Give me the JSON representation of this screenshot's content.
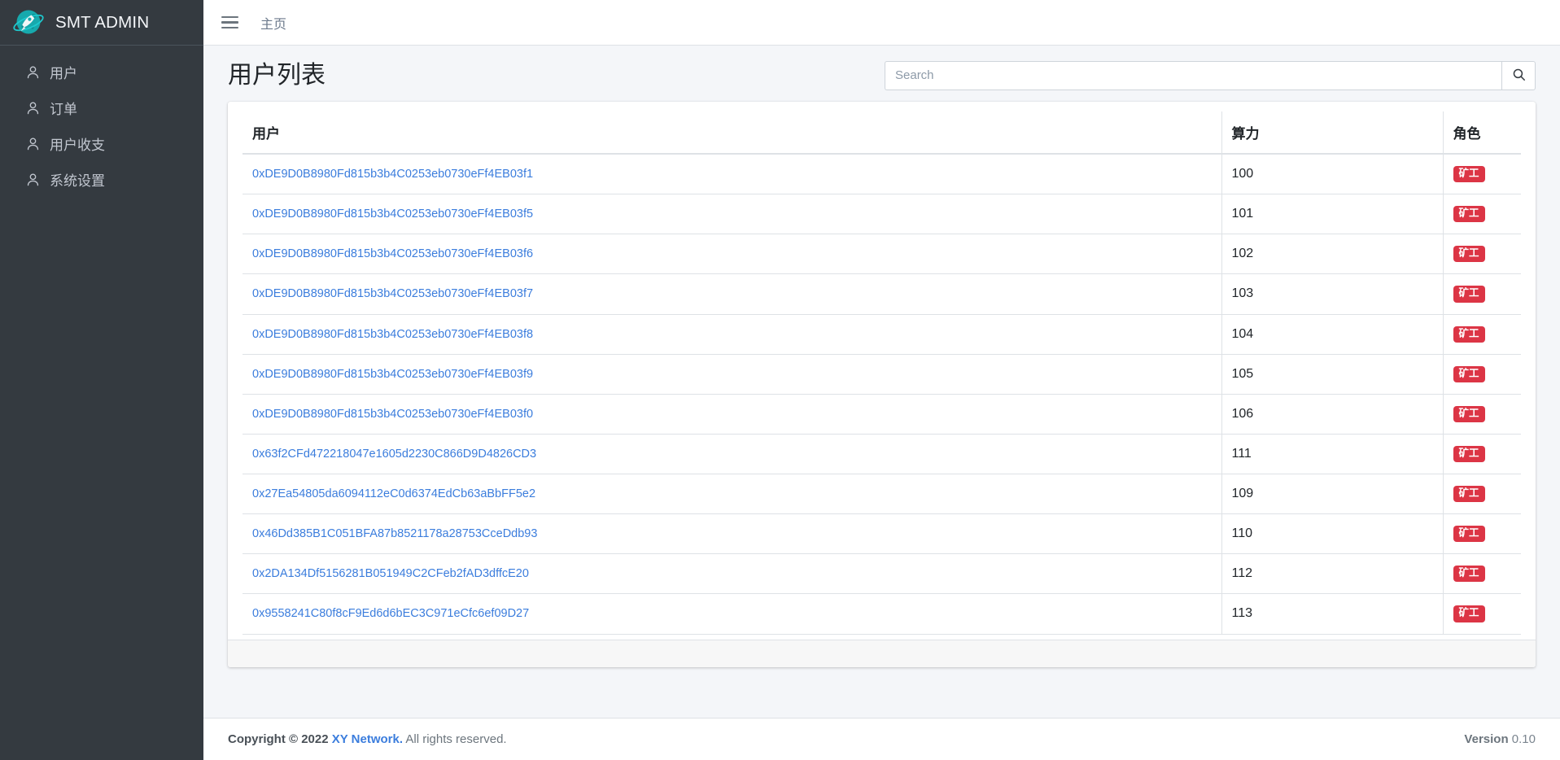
{
  "sidebar": {
    "brand": {
      "title": "SMT ADMIN",
      "logo_icon": "rocket-planet-logo"
    },
    "items": [
      {
        "label": "用户",
        "icon": "user-icon"
      },
      {
        "label": "订单",
        "icon": "user-icon"
      },
      {
        "label": "用户收支",
        "icon": "user-icon"
      },
      {
        "label": "系统设置",
        "icon": "user-icon"
      }
    ]
  },
  "topbar": {
    "menu_icon": "hamburger-icon",
    "home_label": "主页"
  },
  "page": {
    "title": "用户列表"
  },
  "search": {
    "value": "",
    "placeholder": "Search",
    "button_icon": "search-icon"
  },
  "table": {
    "columns": [
      "用户",
      "算力",
      "角色"
    ],
    "rows": [
      {
        "user": "0xDE9D0B8980Fd815b3b4C0253eb0730eFf4EB03f1",
        "power": "100",
        "role": "矿工"
      },
      {
        "user": "0xDE9D0B8980Fd815b3b4C0253eb0730eFf4EB03f5",
        "power": "101",
        "role": "矿工"
      },
      {
        "user": "0xDE9D0B8980Fd815b3b4C0253eb0730eFf4EB03f6",
        "power": "102",
        "role": "矿工"
      },
      {
        "user": "0xDE9D0B8980Fd815b3b4C0253eb0730eFf4EB03f7",
        "power": "103",
        "role": "矿工"
      },
      {
        "user": "0xDE9D0B8980Fd815b3b4C0253eb0730eFf4EB03f8",
        "power": "104",
        "role": "矿工"
      },
      {
        "user": "0xDE9D0B8980Fd815b3b4C0253eb0730eFf4EB03f9",
        "power": "105",
        "role": "矿工"
      },
      {
        "user": "0xDE9D0B8980Fd815b3b4C0253eb0730eFf4EB03f0",
        "power": "106",
        "role": "矿工"
      },
      {
        "user": "0x63f2CFd472218047e1605d2230C866D9D4826CD3",
        "power": "111",
        "role": "矿工"
      },
      {
        "user": "0x27Ea54805da6094112eC0d6374EdCb63aBbFF5e2",
        "power": "109",
        "role": "矿工"
      },
      {
        "user": "0x46Dd385B1C051BFA87b8521178a28753CceDdb93",
        "power": "110",
        "role": "矿工"
      },
      {
        "user": "0x2DA134Df5156281B051949C2CFeb2fAD3dffcE20",
        "power": "112",
        "role": "矿工"
      },
      {
        "user": "0x9558241C80f8cF9Ed6d6bEC3C971eCfc6ef09D27",
        "power": "113",
        "role": "矿工"
      }
    ]
  },
  "footer": {
    "copyright_prefix": "Copyright © 2022",
    "brand": "XY Network.",
    "rights": "All rights reserved.",
    "version_label": "Version",
    "version_number": "0.10"
  },
  "colors": {
    "sidebar_bg": "#343a40",
    "accent_link": "#3b7ddd",
    "badge_danger": "#dc3545",
    "logo_teal": "#17a2a8",
    "page_bg": "#f4f6f9"
  }
}
